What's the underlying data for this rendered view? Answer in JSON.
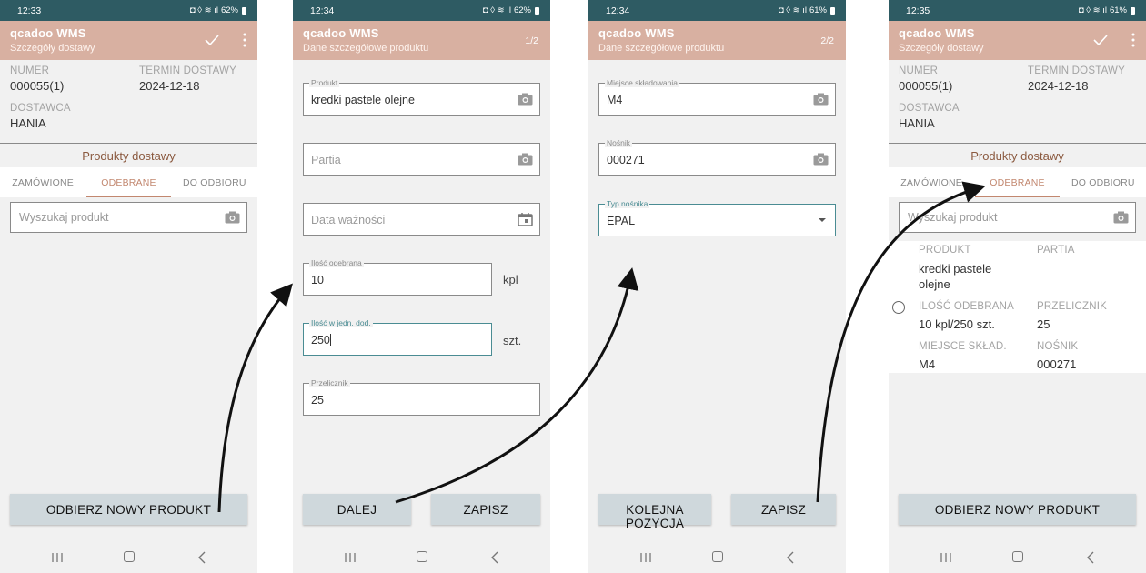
{
  "app": {
    "title": "qcadoo WMS",
    "accent": "#d8b0a1",
    "statusbar_color": "#2e5b63"
  },
  "screen1": {
    "status": {
      "time": "12:33",
      "battery": "62%"
    },
    "subtitle": "Szczegóły dostawy",
    "numer_label": "NUMER",
    "numer": "000055(1)",
    "termin_label": "TERMIN DOSTAWY",
    "termin": "2024-12-18",
    "dostawca_label": "DOSTAWCA",
    "dostawca": "HANIA",
    "section_title": "Produkty dostawy",
    "tabs": [
      "ZAMÓWIONE",
      "ODEBRANE",
      "DO ODBIORU"
    ],
    "active_tab": "ODEBRANE",
    "search_placeholder": "Wyszukaj produkt",
    "button": "ODBIERZ NOWY PRODUKT"
  },
  "screen2": {
    "status": {
      "time": "12:34",
      "battery": "62%"
    },
    "subtitle": "Dane szczegółowe produktu",
    "step": "1/2",
    "produkt_label": "Produkt",
    "produkt": "kredki pastele olejne",
    "partia_placeholder": "Partia",
    "data_placeholder": "Data ważności",
    "ilosc_label": "Ilość odebrana",
    "ilosc": "10",
    "ilosc_unit": "kpl",
    "ilosc_dod_label": "Ilość w jedn. dod.",
    "ilosc_dod": "250",
    "ilosc_dod_unit": "szt.",
    "przelicznik_label": "Przelicznik",
    "przelicznik": "25",
    "btn_next": "DALEJ",
    "btn_save": "ZAPISZ"
  },
  "screen3": {
    "status": {
      "time": "12:34",
      "battery": "61%"
    },
    "subtitle": "Dane szczegółowe produktu",
    "step": "2/2",
    "miejsce_label": "Miejsce składowania",
    "miejsce": "M4",
    "nosnik_label": "Nośnik",
    "nosnik": "000271",
    "typ_label": "Typ nośnika",
    "typ": "EPAL",
    "btn_next": "KOLEJNA POZYCJA",
    "btn_save": "ZAPISZ"
  },
  "screen4": {
    "status": {
      "time": "12:35",
      "battery": "61%"
    },
    "subtitle": "Szczegóły dostawy",
    "numer_label": "NUMER",
    "numer": "000055(1)",
    "termin_label": "TERMIN DOSTAWY",
    "termin": "2024-12-18",
    "dostawca_label": "DOSTAWCA",
    "dostawca": "HANIA",
    "section_title": "Produkty dostawy",
    "tabs": [
      "ZAMÓWIONE",
      "ODEBRANE",
      "DO ODBIORU"
    ],
    "active_tab": "ODEBRANE",
    "search_placeholder": "Wyszukaj produkt",
    "item": {
      "produkt_label": "PRODUKT",
      "produkt_line1": "kredki pastele",
      "produkt_line2": "olejne",
      "partia_label": "PARTIA",
      "ilosc_label": "ILOŚĆ ODEBRANA",
      "ilosc": "10 kpl/250 szt.",
      "przelicznik_label": "PRZELICZNIK",
      "przelicznik": "25",
      "miejsce_label": "MIEJSCE SKŁAD.",
      "miejsce": "M4",
      "nosnik_label": "NOŚNIK",
      "nosnik": "000271"
    },
    "button": "ODBIERZ NOWY PRODUKT"
  }
}
